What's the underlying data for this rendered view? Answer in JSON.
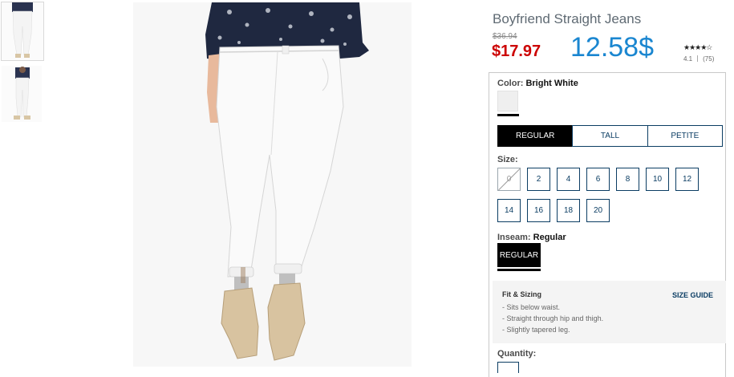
{
  "product": {
    "title": "Boyfriend Straight Jeans",
    "original_price": "$36.94",
    "sale_price": "$17.97",
    "promo_price": "12.58$",
    "rating_stars": "★★★★☆",
    "rating_value": "4.1",
    "review_count": "(75)"
  },
  "gallery": {
    "thumbnails": [
      "front-view",
      "full-length-view"
    ],
    "main_image": "white boyfriend jeans on model"
  },
  "color": {
    "label": "Color:",
    "value": "Bright White",
    "swatch_hex": "#efefef"
  },
  "fit_tabs": [
    "REGULAR",
    "TALL",
    "PETITE"
  ],
  "fit_selected": "REGULAR",
  "size": {
    "label": "Size:",
    "options": [
      "0",
      "2",
      "4",
      "6",
      "8",
      "10",
      "12",
      "14",
      "16",
      "18",
      "20"
    ],
    "unavailable": [
      "0"
    ]
  },
  "inseam": {
    "label": "Inseam:",
    "value": "Regular",
    "options": [
      "REGULAR"
    ]
  },
  "fit_sizing": {
    "title": "Fit & Sizing",
    "size_guide": "SIZE GUIDE",
    "bullets": [
      "- Sits below waist.",
      "- Straight through hip and thigh.",
      "- Slightly tapered leg."
    ]
  },
  "quantity": {
    "label": "Quantity:"
  },
  "colors": {
    "sale_red": "#cc0000",
    "promo_blue": "#1a86d0",
    "navy": "#0b3d63"
  }
}
